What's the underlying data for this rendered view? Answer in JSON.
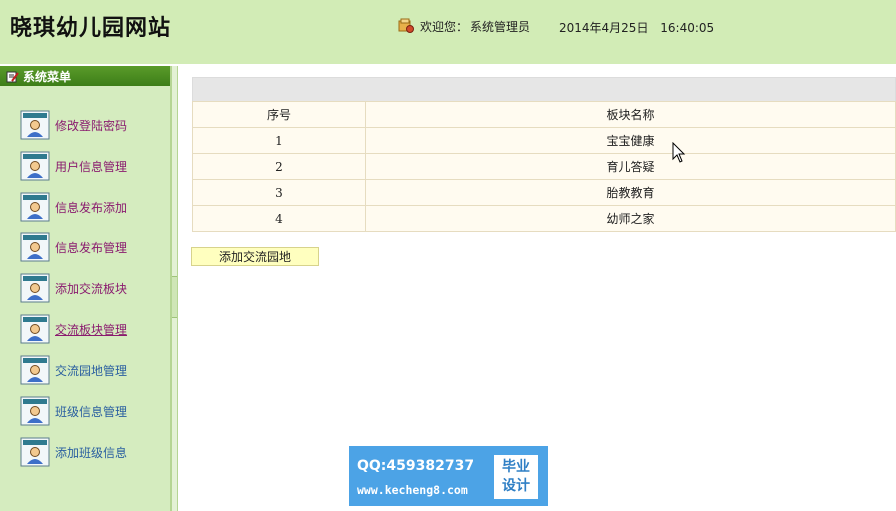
{
  "header": {
    "site_title": "晓琪幼儿园网站",
    "welcome_label": "欢迎您：",
    "user_name": "系统管理员",
    "date": "2014年4月25日",
    "time": "16:40:05"
  },
  "sidebar": {
    "title": "系统菜单",
    "items": [
      {
        "label": "修改登陆密码"
      },
      {
        "label": "用户信息管理"
      },
      {
        "label": "信息发布添加"
      },
      {
        "label": "信息发布管理"
      },
      {
        "label": "添加交流板块"
      },
      {
        "label": "交流板块管理"
      },
      {
        "label": "交流园地管理"
      },
      {
        "label": "班级信息管理"
      },
      {
        "label": "添加班级信息"
      }
    ]
  },
  "table": {
    "headers": [
      "序号",
      "板块名称"
    ],
    "rows": [
      {
        "num": "1",
        "name": "宝宝健康"
      },
      {
        "num": "2",
        "name": "育儿答疑"
      },
      {
        "num": "3",
        "name": "胎教教育"
      },
      {
        "num": "4",
        "name": "幼师之家"
      }
    ]
  },
  "actions": {
    "add_label": "添加交流园地"
  },
  "watermark": {
    "qq": "QQ:459382737",
    "url": "www.kecheng8.com",
    "badge_line1": "毕业",
    "badge_line2": "设计"
  },
  "colors": {
    "header_bg": "#d2ecb6",
    "sidebar_bg": "#d5ecbf",
    "sidebar_title_bg": "#3d7e18",
    "menu_text": "#8a1b6f",
    "button_bg": "#ffffbf",
    "watermark_bg": "#4ca3e6"
  }
}
